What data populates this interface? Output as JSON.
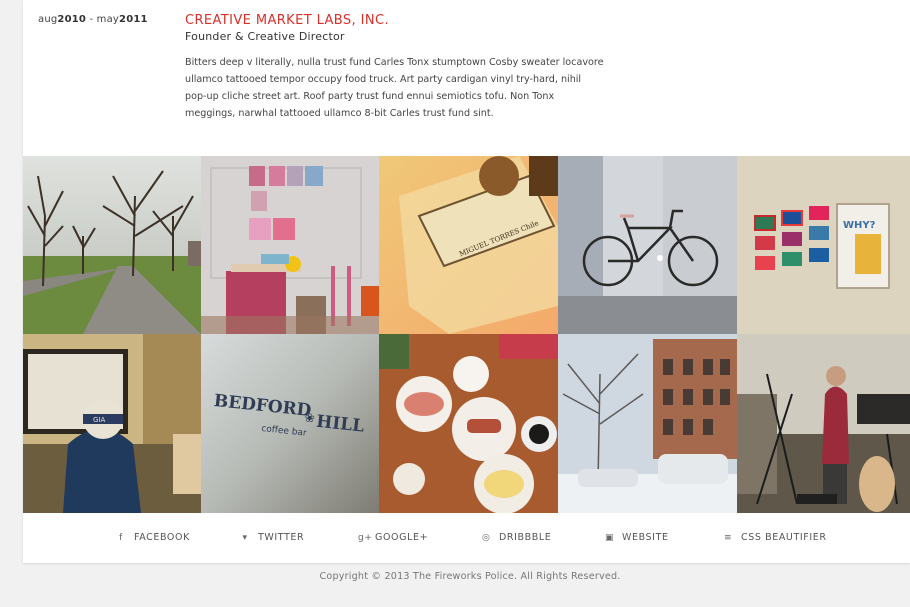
{
  "job": {
    "date_start_month": "aug",
    "date_start_year": "2010",
    "date_sep": " - ",
    "date_end_month": "may",
    "date_end_year": "2011",
    "company": "CREATIVE MARKET LABS, INC.",
    "role": "Founder & Creative Director",
    "description": "Bitters deep v literally, nulla trust fund Carles Tonx stumptown Cosby sweater locavore ullamco tattooed tempor occupy food truck. Art party cardigan vinyl try-hard, nihil pop-up cliche street art. Roof party trust fund ennui semiotics tofu. Non Tonx meggings, narwhal tattooed ullamco 8-bit Carles trust fund sint."
  },
  "gallery": {
    "bedford_sign_top": "BEDFORD",
    "bedford_sign_sep": "❀",
    "bedford_sign_hill": "HILL",
    "bedford_sign_sub": "coffee bar",
    "bottle_label": "MIGUEL TORRES Chile",
    "poster_text": "WHY?",
    "hat_text": "GIA",
    "photos": [
      {
        "name": "park-trees-photo"
      },
      {
        "name": "kids-room-photo"
      },
      {
        "name": "bottle-photo"
      },
      {
        "name": "bicycle-photo"
      },
      {
        "name": "framed-art-wall-photo"
      },
      {
        "name": "man-at-desk-photo"
      },
      {
        "name": "bedford-hill-sign-photo"
      },
      {
        "name": "breakfast-table-photo"
      },
      {
        "name": "snowy-street-photo"
      },
      {
        "name": "music-studio-photo"
      }
    ]
  },
  "social": {
    "links": [
      {
        "icon": "f",
        "icon_name": "facebook-icon",
        "label": "FACEBOOK"
      },
      {
        "icon": "ὂ6",
        "icon_name": "twitter-icon",
        "label": "TWITTER"
      },
      {
        "icon": "g+",
        "icon_name": "google-plus-icon",
        "label": "GOOGLE+"
      },
      {
        "icon": "◎",
        "icon_name": "dribbble-icon",
        "label": "DRIBBBLE"
      },
      {
        "icon": "▣",
        "icon_name": "website-icon",
        "label": "WEBSITE"
      },
      {
        "icon": "≡",
        "icon_name": "css-icon",
        "label": "CSS BEAUTIFIER"
      }
    ]
  },
  "footer": {
    "copyright": "Copyright © 2013 The Fireworks Police. All Rights Reserved."
  }
}
